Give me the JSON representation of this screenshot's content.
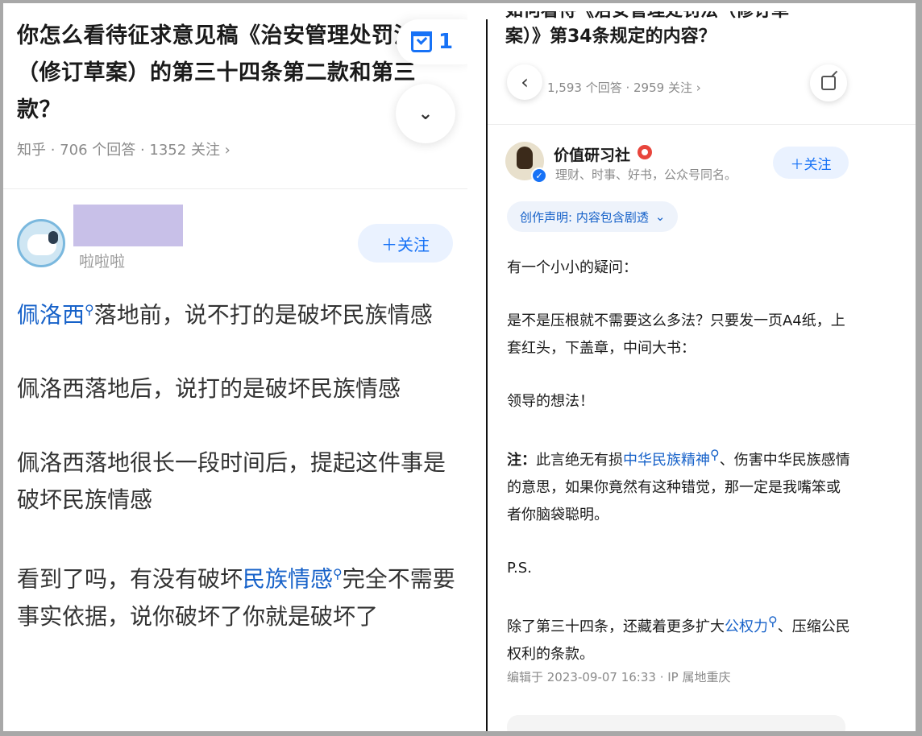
{
  "left": {
    "question_title": "你怎么看待征求意见稿《治安管理处罚法》（修订草案）的第三十四条第二款和第三款？",
    "favorite_count": "1",
    "meta": "知乎 · 706 个回答 · 1352 关注 ›",
    "author_sub": "啦啦啦",
    "follow_label": "＋关注",
    "answer": [
      {
        "link": "佩洛西",
        "text": "落地前，说不打的是破坏民族情感"
      },
      {
        "text": "佩洛西落地后，说打的是破坏民族情感"
      },
      {
        "text": "佩洛西落地很长一段时间后，提起这件事是破坏民族情感"
      },
      {
        "pre": "看到了吗，有没有破坏",
        "link": "民族情感",
        "text": "完全不需要事实依据，说你破坏了你就是破坏了"
      }
    ]
  },
  "right": {
    "title_cut": "如何看待《治安管理处罚法（修订草",
    "title_line2": "案）》第34条规定的内容？",
    "meta": "1,593 个回答 · 2959 关注 ›",
    "author_name": "价值研习社",
    "author_bio": "理财、时事、好书，公众号同名。",
    "follow_label": "＋关注",
    "declaration": "创作声明: 内容包含剧透",
    "paragraphs": {
      "p1": "有一个小小的疑问：",
      "p2": "是不是压根就不需要这么多法？只要发一页A4纸，上套红头，下盖章，中间大书：",
      "p3": "领导的想法！",
      "p4_label": "注：",
      "p4_pre": "此言绝无有损",
      "p4_link": "中华民族精神",
      "p4_post": "、伤害中华民族感情的意思，如果你竟然有这种错觉，那一定是我嘴笨或者你脑袋聪明。",
      "p5": "P.S.",
      "p6_pre": "除了第三十四条，还藏着更多扩大",
      "p6_link": "公权力",
      "p6_post": "、压缩公民权利的条款。"
    },
    "edit_info": "编辑于 2023-09-07 16:33 · IP 属地重庆"
  },
  "icons": [
    "favorite-icon",
    "chevron-double-down-icon",
    "back-icon",
    "share-icon",
    "verified-icon",
    "search-icon"
  ],
  "colors": {
    "accent": "#1772f6",
    "link": "#1762c9",
    "meta": "#8a8a8a"
  }
}
